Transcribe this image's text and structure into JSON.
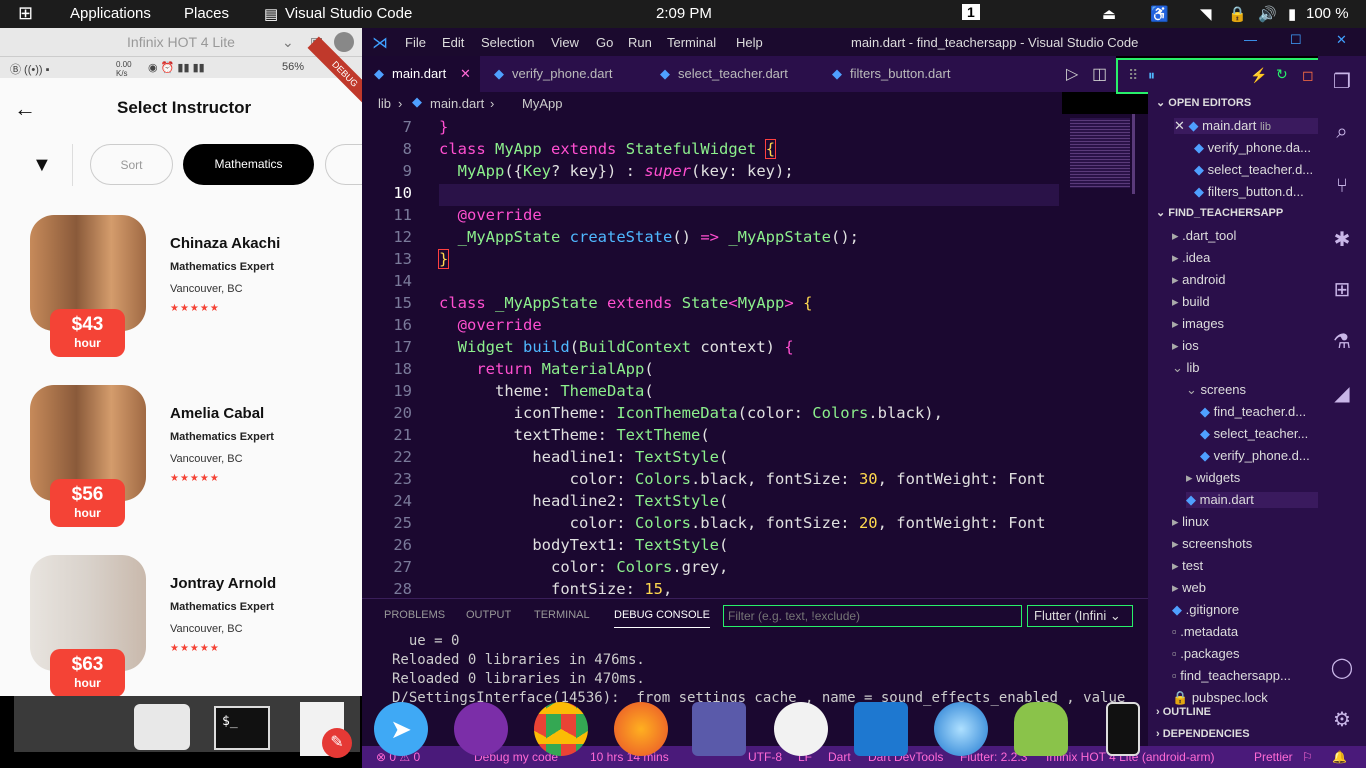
{
  "topbar": {
    "applications": "Applications",
    "places": "Places",
    "app": "Visual Studio Code",
    "time": "2:09 PM",
    "workspace": "1",
    "battery": "100 %"
  },
  "phone": {
    "window_title": "Infinix HOT 4 Lite",
    "status_left": "0.00 K/s",
    "battery": "56%",
    "debug": "DEBUG",
    "page_title": "Select Instructor",
    "chips": [
      "Sort",
      "Mathematics"
    ],
    "instructors": [
      {
        "name": "Chinaza Akachi",
        "subject": "Mathematics Expert",
        "location": "Vancouver, BC",
        "price": "$43",
        "unit": "hour",
        "stars": "★★★★★"
      },
      {
        "name": "Amelia Cabal",
        "subject": "Mathematics Expert",
        "location": "Vancouver, BC",
        "price": "$56",
        "unit": "hour",
        "stars": "★★★★★"
      },
      {
        "name": "Jontray Arnold",
        "subject": "Mathematics Expert",
        "location": "Vancouver, BC",
        "price": "$63",
        "unit": "hour",
        "stars": "★★★★★"
      }
    ]
  },
  "vscode": {
    "menu": [
      "File",
      "Edit",
      "Selection",
      "View",
      "Go",
      "Run",
      "Terminal",
      "Help"
    ],
    "window_title": "main.dart - find_teachersapp - Visual Studio Code",
    "tabs": [
      "main.dart",
      "verify_phone.dart",
      "select_teacher.dart",
      "filters_button.dart"
    ],
    "breadcrumb": [
      "lib",
      "main.dart",
      "MyApp"
    ],
    "line_numbers": [
      "7",
      "8",
      "9",
      "10",
      "11",
      "12",
      "13",
      "14",
      "15",
      "16",
      "17",
      "18",
      "19",
      "20",
      "21",
      "22",
      "23",
      "24",
      "25",
      "26",
      "27",
      "28"
    ],
    "panel_tabs": [
      "PROBLEMS",
      "OUTPUT",
      "TERMINAL",
      "DEBUG CONSOLE"
    ],
    "filter_placeholder": "Filter (e.g. text, !exclude)",
    "device_select": "Flutter (Infini",
    "console": [
      "  ue = 0",
      "Reloaded 0 libraries in 476ms.",
      "Reloaded 0 libraries in 470ms.",
      "D/SettingsInterface(14536):  from settings cache , name = sound_effects_enabled , value"
    ],
    "explorer": {
      "open_editors": "OPEN EDITORS",
      "open_files": [
        "main.dart",
        "verify_phone.da...",
        "select_teacher.d...",
        "filters_button.d..."
      ],
      "open_file_hint": "lib",
      "project": "FIND_TEACHERSAPP",
      "items": [
        ".dart_tool",
        ".idea",
        "android",
        "build",
        "images",
        "ios",
        "lib",
        "screens",
        "find_teacher.d...",
        "select_teacher...",
        "verify_phone.d...",
        "widgets",
        "main.dart",
        "linux",
        "screenshots",
        "test",
        "web",
        ".gitignore",
        ".metadata",
        ".packages",
        "find_teachersapp...",
        "pubspec.lock"
      ],
      "outline": "OUTLINE",
      "dependencies": "DEPENDENCIES"
    },
    "status": [
      "⊗ 0 ⚠ 0",
      "Debug my code",
      "10 hrs 14 mins",
      "UTF-8",
      "LF",
      "Dart",
      "Dart DevTools",
      "Flutter: 2.2.3",
      "Infinix HOT 4 Lite (android-arm)",
      "Prettier"
    ]
  },
  "colors": {
    "accent": "#f44336",
    "highlight": "#28f06a",
    "vscode_bg": "#1b0830"
  }
}
